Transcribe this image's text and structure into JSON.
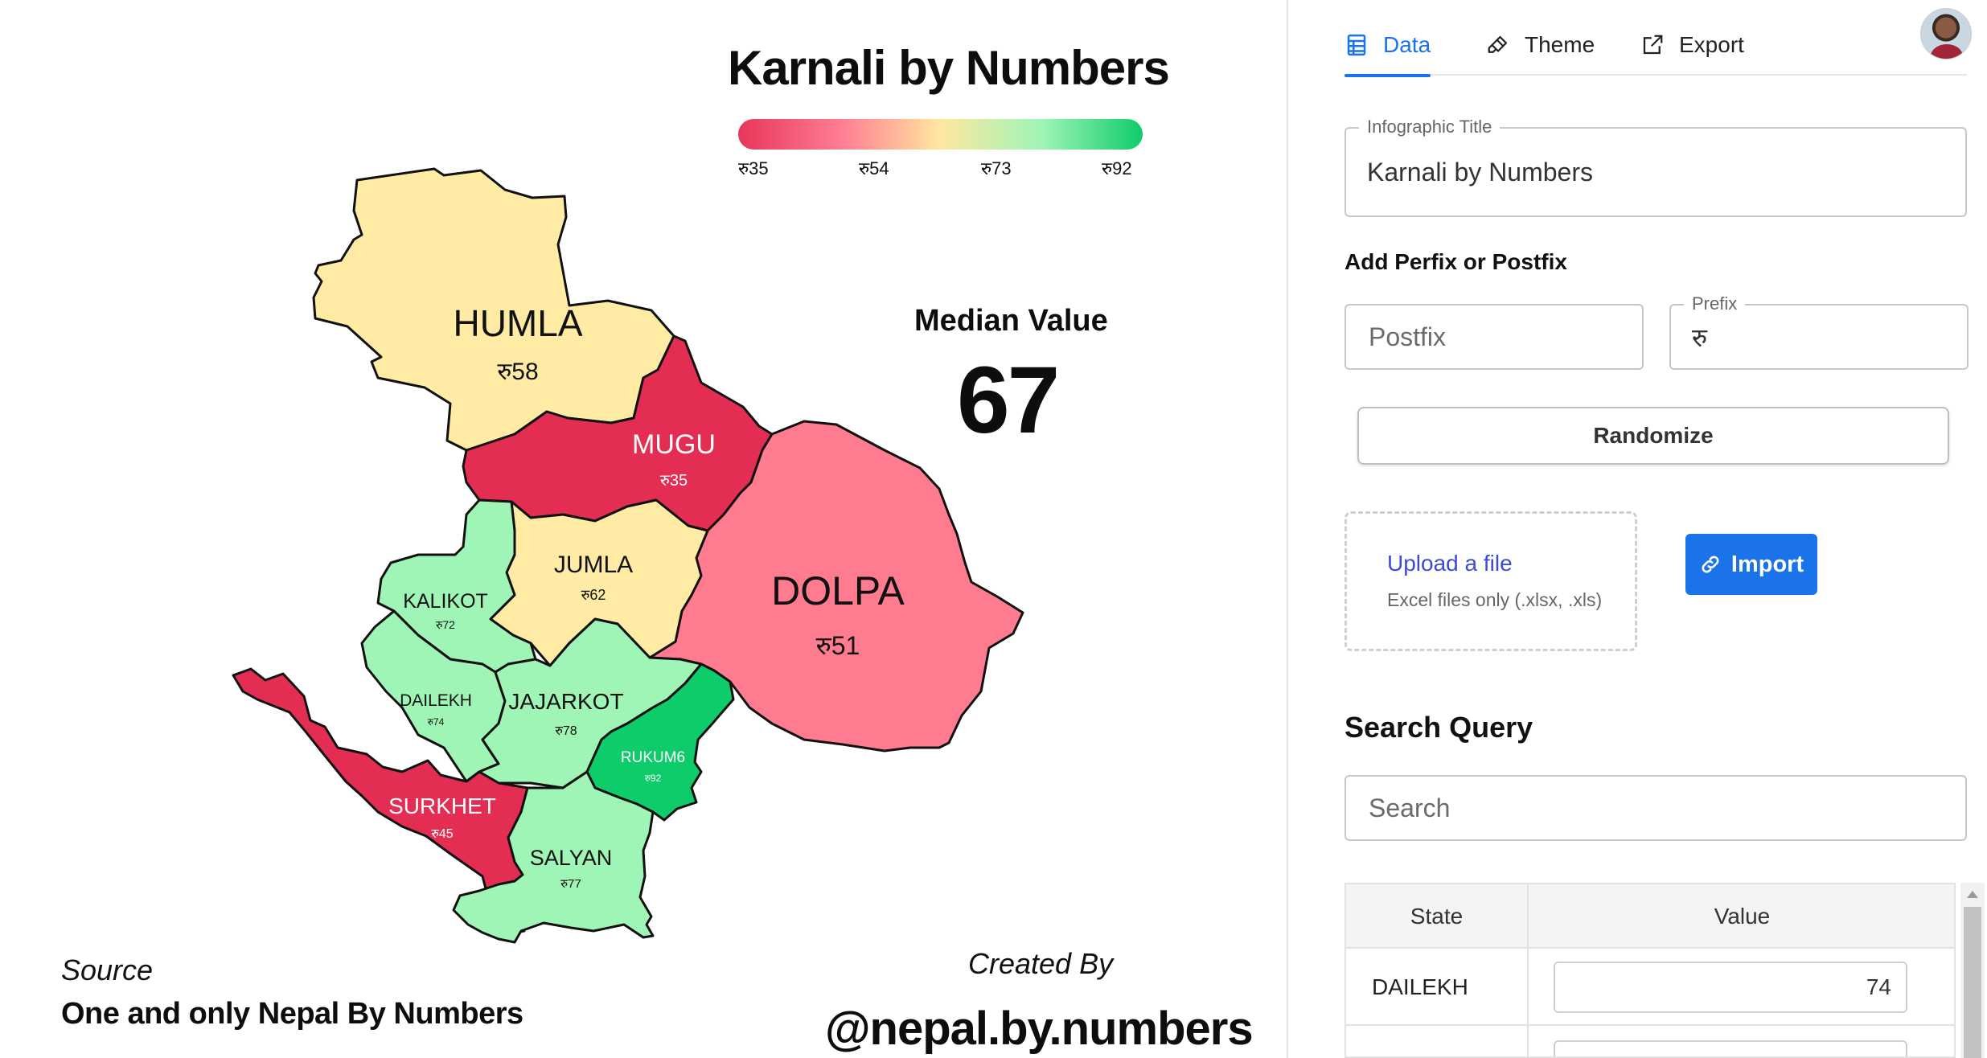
{
  "infographic": {
    "title": "Karnali by Numbers",
    "legend": {
      "colors": [
        "#e8365a",
        "#ff7b93",
        "#ffe7a0",
        "#9ff5b6",
        "#0fcc6a"
      ],
      "labels": [
        "रु35",
        "रु54",
        "रु73",
        "रु92"
      ]
    },
    "median_label": "Median Value",
    "median_value": "67",
    "source_label": "Source",
    "source_text": "One and only Nepal By Numbers",
    "created_label": "Created By",
    "created_handle": "@nepal.by.numbers",
    "regions": [
      {
        "name": "HUMLA",
        "value": "रु58",
        "color": "#ffeba3"
      },
      {
        "name": "MUGU",
        "value": "रु35",
        "color": "#e32d52"
      },
      {
        "name": "DOLPA",
        "value": "रु51",
        "color": "#ff7b8f"
      },
      {
        "name": "JUMLA",
        "value": "रु62",
        "color": "#ffeba3"
      },
      {
        "name": "KALIKOT",
        "value": "रु72",
        "color": "#9ff5b6"
      },
      {
        "name": "DAILEKH",
        "value": "रु74",
        "color": "#9ff5b6"
      },
      {
        "name": "JAJARKOT",
        "value": "रु78",
        "color": "#9ff5b6"
      },
      {
        "name": "RUKUM6",
        "value": "रु92",
        "color": "#0fcc6a"
      },
      {
        "name": "SURKHET",
        "value": "रु45",
        "color": "#e32d52"
      },
      {
        "name": "SALYAN",
        "value": "रु77",
        "color": "#9ff5b6"
      }
    ]
  },
  "panel": {
    "tabs": [
      {
        "label": "Data"
      },
      {
        "label": "Theme"
      },
      {
        "label": "Export"
      }
    ],
    "title_field": {
      "label": "Infographic Title",
      "value": "Karnali by Numbers"
    },
    "affix_heading": "Add Perfix or Postfix",
    "postfix_field": {
      "placeholder": "Postfix"
    },
    "prefix_field": {
      "label": "Prefix",
      "value": "रु"
    },
    "randomize_label": "Randomize",
    "upload": {
      "link": "Upload a file",
      "hint": "Excel files only (.xlsx, .xls)"
    },
    "import_label": "Import",
    "search_heading": "Search Query",
    "search_field": {
      "placeholder": "Search"
    },
    "table": {
      "headers": [
        "State",
        "Value"
      ],
      "rows": [
        {
          "state": "DAILEKH",
          "value": "74"
        }
      ]
    }
  },
  "accent_color": "#1a73e8"
}
